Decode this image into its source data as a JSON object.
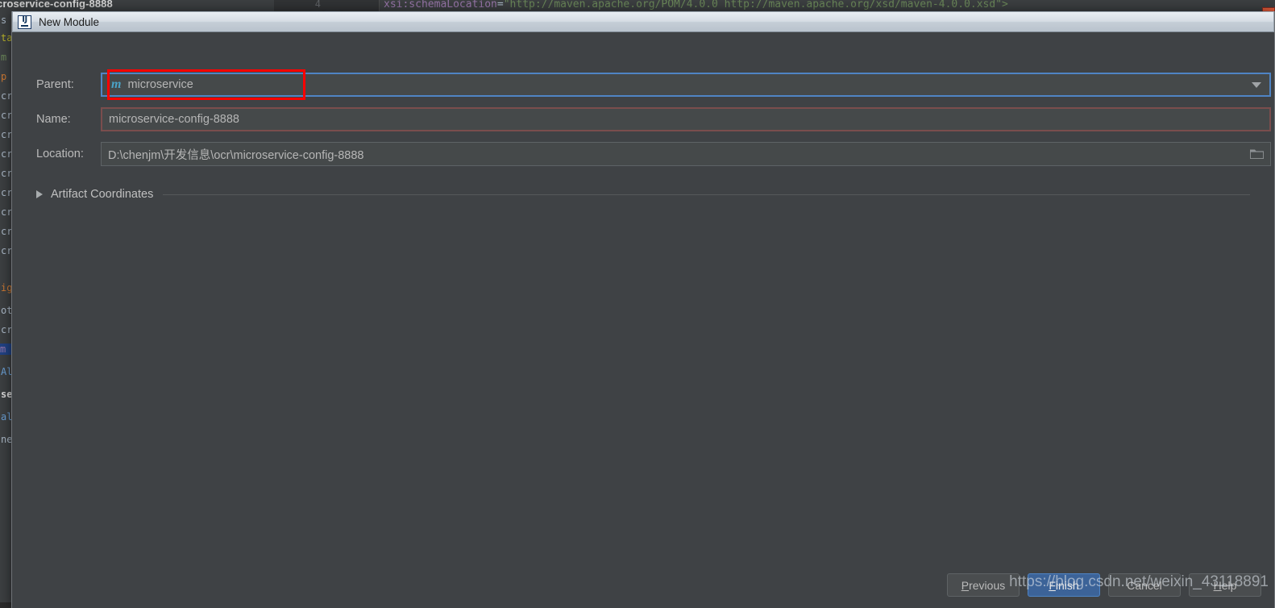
{
  "background": {
    "editor_tab_label": "croservice-config-8888",
    "line_number": "4",
    "code": {
      "attribute": "xsi:schemaLocation",
      "equals": "=",
      "value": "\"http://maven.apache.org/POM/4.0.0 http://maven.apache.org/xsd/maven-4.0.0.xsd\">"
    },
    "left_fragments": [
      "s",
      "ta",
      "m",
      "p",
      "cr",
      "cr",
      "cr",
      "cr",
      "cr",
      "cr",
      "cr",
      "cr",
      "cr",
      "ig",
      "ot",
      "cr",
      "m",
      "Al",
      "se",
      "al",
      "ne"
    ]
  },
  "dialog": {
    "title": "New Module",
    "icon": "intellij-idea-icon",
    "fields": {
      "parent": {
        "label": "Parent:",
        "value": "microservice",
        "icon": "maven-module-icon",
        "dropdown_icon": "chevron-down-icon",
        "state": "focused"
      },
      "name": {
        "label": "Name:",
        "value": "microservice-config-8888",
        "state": "warning"
      },
      "location": {
        "label": "Location:",
        "value": "D:\\chenjm\\开发信息\\ocr\\microservice-config-8888",
        "browse_icon": "folder-icon",
        "state": "normal"
      }
    },
    "artifact_coordinates": {
      "label": "Artifact Coordinates",
      "expanded": false,
      "toggle_icon": "chevron-right-icon"
    },
    "buttons": {
      "previous": {
        "label_prefix": "P",
        "label_rest": "revious"
      },
      "finish": {
        "label_prefix": "F",
        "label_rest": "inish",
        "primary": true
      },
      "cancel": {
        "label": "Cancel"
      },
      "help": {
        "label_prefix": "H",
        "label_rest": "elp"
      }
    }
  },
  "watermark": "https://blog.csdn.net/weixin_43118891",
  "colors": {
    "dialog_background": "#3f4245",
    "field_background": "#45494a",
    "focus_border": "#4f84c4",
    "warning_border": "#7a4d4d",
    "annotation_red": "#ff0000",
    "primary_button": "#3c6398",
    "maven_icon": "#4aa3c7"
  }
}
